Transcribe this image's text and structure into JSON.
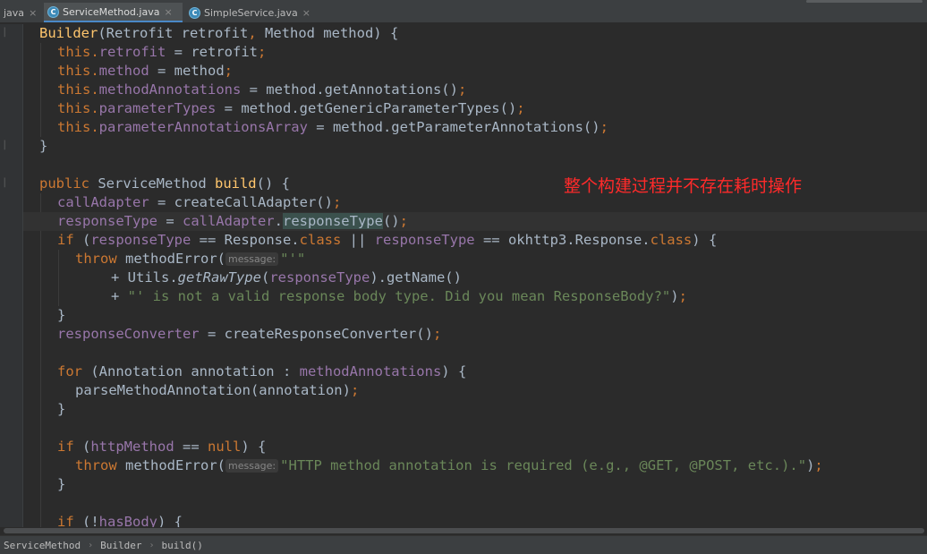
{
  "tabs": [
    {
      "label": "java",
      "close": "×"
    },
    {
      "label": "ServiceMethod.java",
      "close": "×",
      "icon": "C"
    },
    {
      "label": "SimpleService.java",
      "close": "×",
      "icon": "C"
    }
  ],
  "code": {
    "l1": {
      "a": "Builder",
      "b": "(Retrofit retrofit",
      "c": ",",
      "d": " Method method) {"
    },
    "l2": {
      "a": "this.",
      "b": "retrofit",
      "c": " = retrofit",
      "d": ";"
    },
    "l3": {
      "a": "this.",
      "b": "method",
      "c": " = method",
      "d": ";"
    },
    "l4": {
      "a": "this.",
      "b": "methodAnnotations",
      "c": " = method.getAnnotations()",
      "d": ";"
    },
    "l5": {
      "a": "this.",
      "b": "parameterTypes",
      "c": " = method.getGenericParameterTypes()",
      "d": ";"
    },
    "l6": {
      "a": "this.",
      "b": "parameterAnnotationsArray",
      "c": " = method.getParameterAnnotations()",
      "d": ";"
    },
    "l7": {
      "a": "}"
    },
    "l8": {
      "a": "public",
      "b": " ServiceMethod ",
      "c": "build",
      "d": "() {"
    },
    "l9": {
      "a": "callAdapter",
      "b": " = createCallAdapter()",
      "c": ";"
    },
    "l10": {
      "a": "responseType",
      "b": " = ",
      "c": "callAdapter",
      "d": ".",
      "e": "responseType",
      "f": "()",
      "g": ";"
    },
    "l11": {
      "a": "if",
      "b": " (",
      "c": "responseType",
      "d": " == Response.",
      "e": "class",
      "f": " || ",
      "g": "responseType",
      "h": " == okhttp3.Response.",
      "i": "class",
      "j": ") {"
    },
    "l12": {
      "a": "throw",
      "b": " methodError(",
      "hint": "message:",
      "c": "\"'\""
    },
    "l13": {
      "a": "+ Utils.",
      "b": "getRawType",
      "c": "(",
      "d": "responseType",
      "e": ").getName()"
    },
    "l14": {
      "a": "+ ",
      "b": "\"' is not a valid response body type. Did you mean ResponseBody?\"",
      "c": ")",
      "d": ";"
    },
    "l15": {
      "a": "}"
    },
    "l16": {
      "a": "responseConverter",
      "b": " = createResponseConverter()",
      "c": ";"
    },
    "l17": {
      "a": "for",
      "b": " (Annotation annotation : ",
      "c": "methodAnnotations",
      "d": ") {"
    },
    "l18": {
      "a": "parseMethodAnnotation(annotation)",
      "b": ";"
    },
    "l19": {
      "a": "}"
    },
    "l20": {
      "a": "if",
      "b": " (",
      "c": "httpMethod",
      "d": " == ",
      "e": "null",
      "f": ") {"
    },
    "l21": {
      "a": "throw",
      "b": " methodError(",
      "hint": "message:",
      "c": "\"HTTP method annotation is required (e.g., @GET, @POST, etc.).\"",
      "d": ")",
      "e": ";"
    },
    "l22": {
      "a": "}"
    },
    "l23": {
      "a": "if",
      "b": " (!",
      "c": "hasBody",
      "d": ") {"
    }
  },
  "annotation_text": "整个构建过程并不存在耗时操作",
  "breadcrumbs": [
    "ServiceMethod",
    "Builder",
    "build()"
  ],
  "breadcrumb_sep": "›",
  "colors": {
    "keyword": "#cc7832",
    "field": "#9876aa",
    "method": "#ffc66d",
    "string": "#6a8759",
    "annotation": "#ff2a2a",
    "background": "#2b2b2b"
  }
}
